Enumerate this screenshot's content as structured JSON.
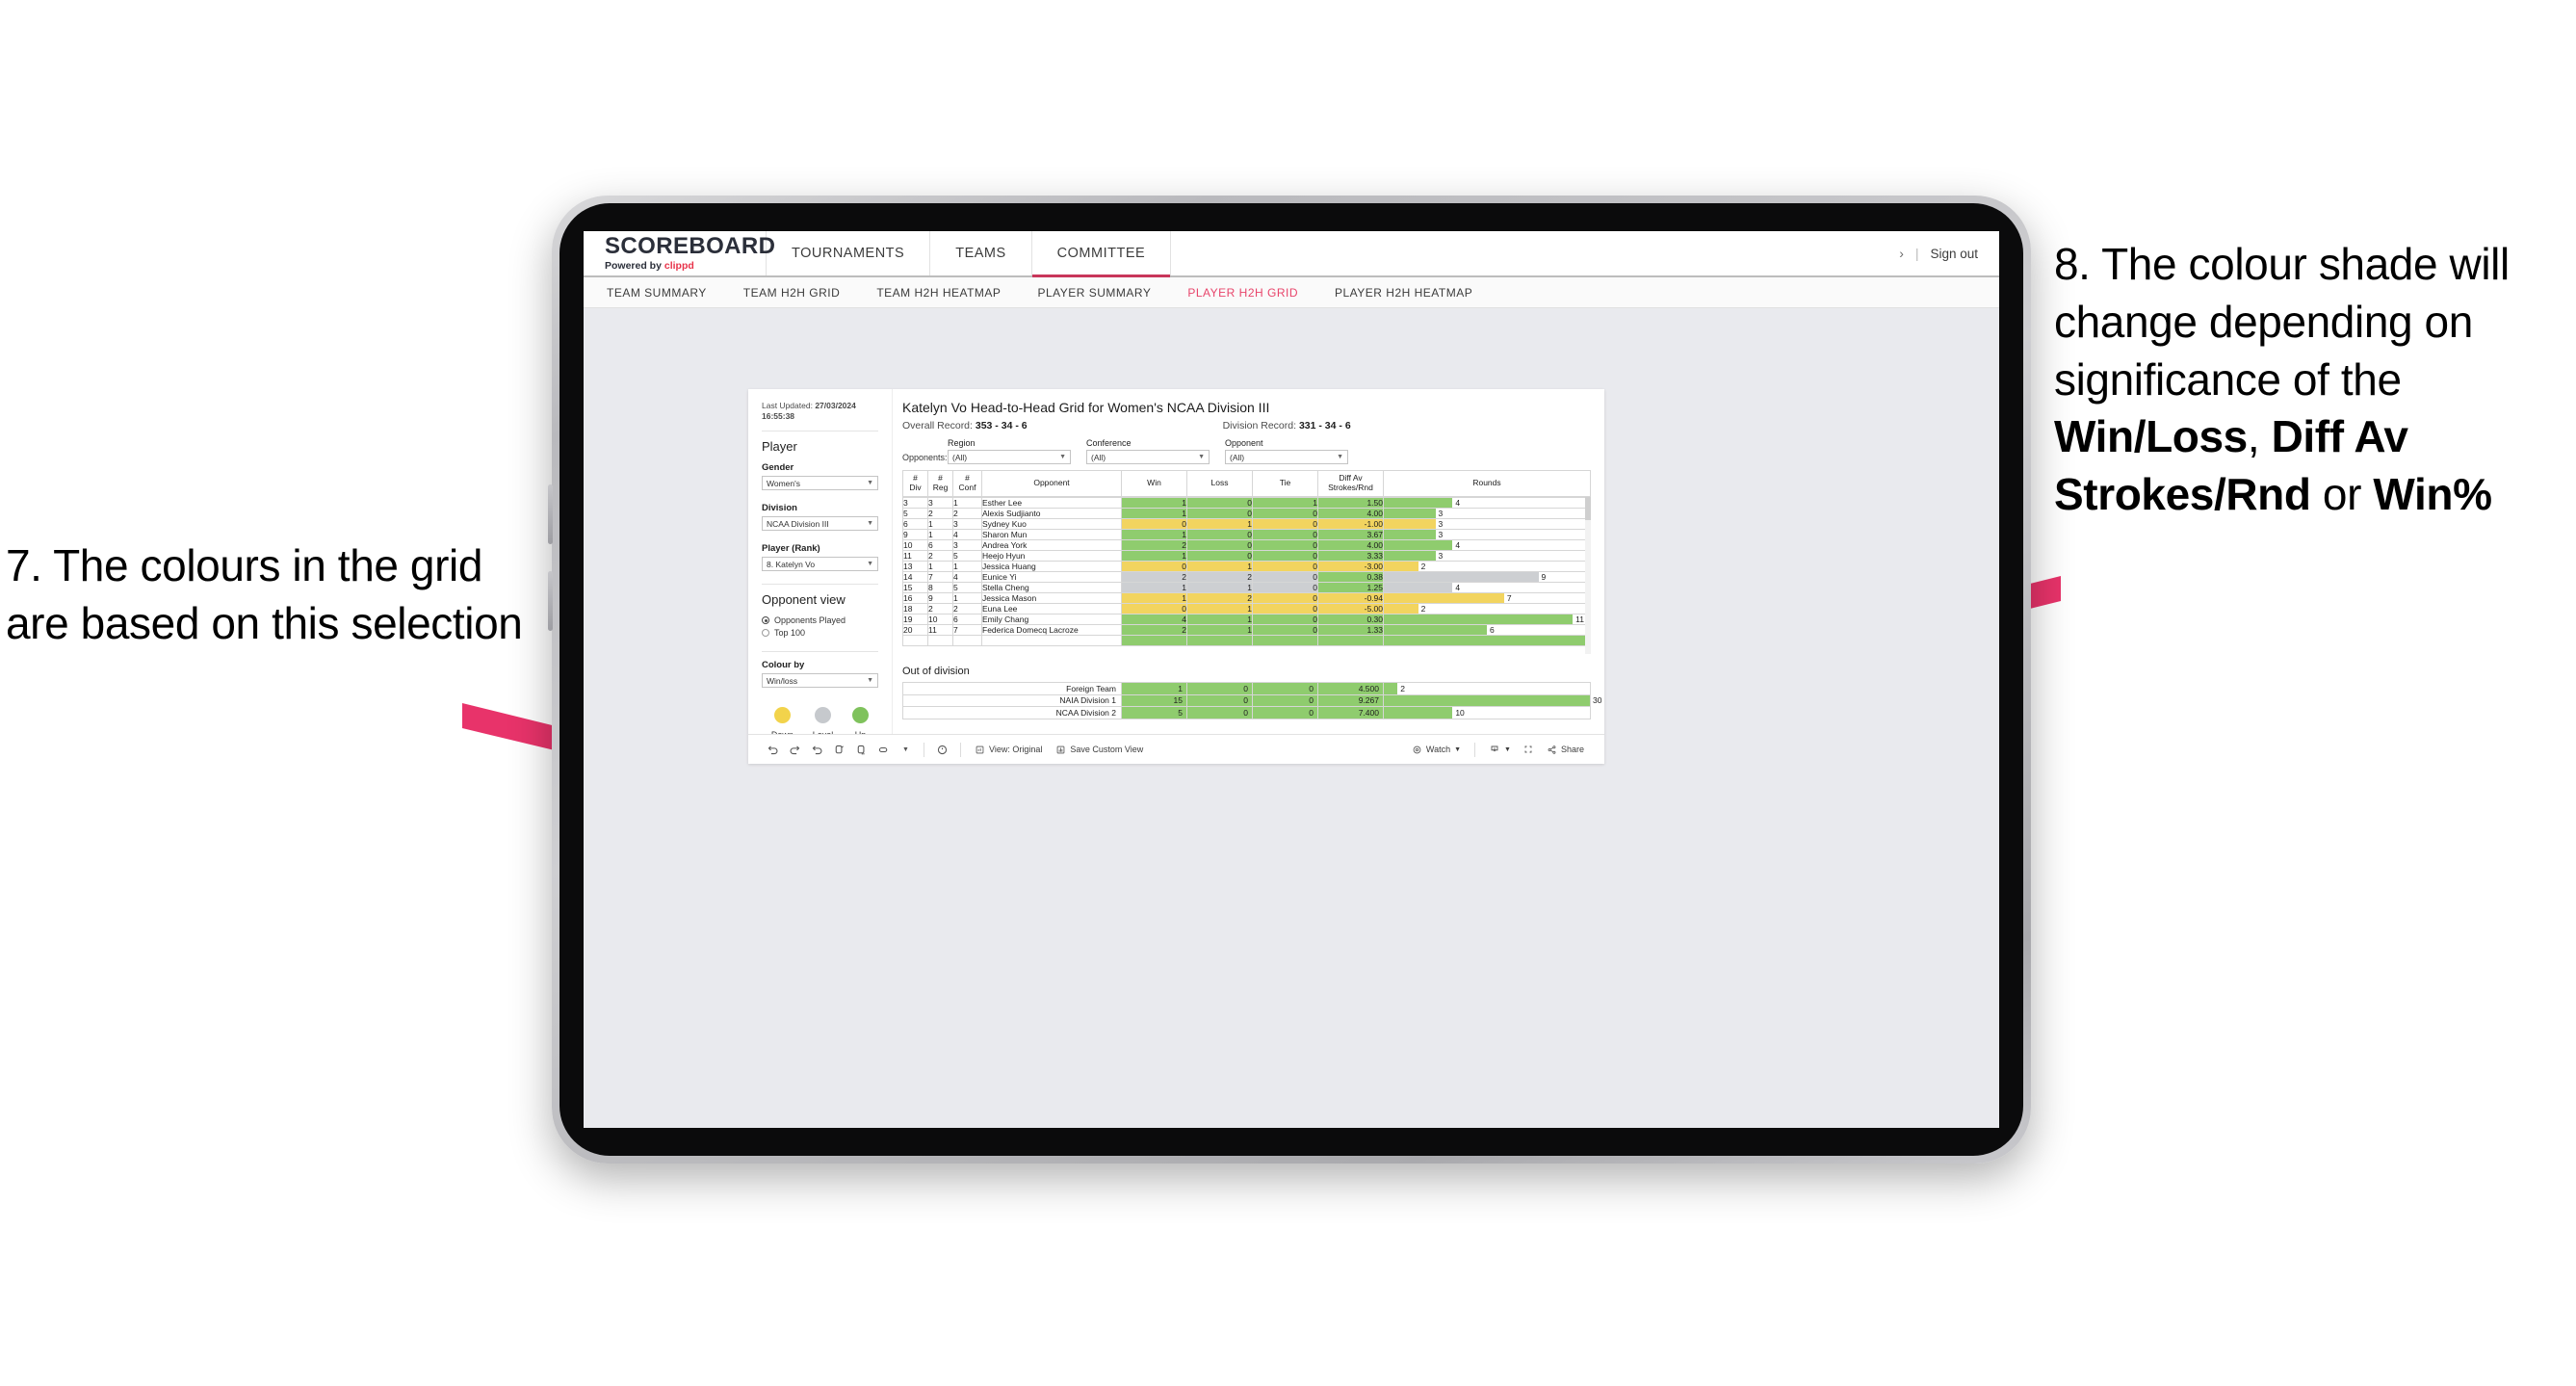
{
  "annotations": {
    "left": "7. The colours in the grid are based on this selection",
    "right_pre": "8. The colour shade will change depending on significance of the ",
    "right_b1": "Win/Loss",
    "right_mid1": ", ",
    "right_b2": "Diff Av Strokes/Rnd",
    "right_mid2": " or ",
    "right_b3": "Win%",
    "arrow_color": "#e8336a"
  },
  "header": {
    "logo_main": "SCOREBOARD",
    "logo_sub_pre": "Powered by ",
    "logo_brand": "clippd",
    "nav": [
      {
        "label": "TOURNAMENTS",
        "active": false
      },
      {
        "label": "TEAMS",
        "active": false
      },
      {
        "label": "COMMITTEE",
        "active": true
      }
    ],
    "chevron": "›",
    "divider": "|",
    "sign_out": "Sign out"
  },
  "subnav": [
    {
      "label": "TEAM SUMMARY",
      "active": false
    },
    {
      "label": "TEAM H2H GRID",
      "active": false
    },
    {
      "label": "TEAM H2H HEATMAP",
      "active": false
    },
    {
      "label": "PLAYER SUMMARY",
      "active": false
    },
    {
      "label": "PLAYER H2H GRID",
      "active": true
    },
    {
      "label": "PLAYER H2H HEATMAP",
      "active": false
    }
  ],
  "sidebar": {
    "last_updated_label": "Last Updated:",
    "last_updated_value": "27/03/2024 16:55:38",
    "section_player": "Player",
    "gender_label": "Gender",
    "gender_value": "Women's",
    "division_label": "Division",
    "division_value": "NCAA Division III",
    "player_label": "Player (Rank)",
    "player_value": "8. Katelyn Vo",
    "opponent_view_label": "Opponent view",
    "opponent_options": [
      {
        "label": "Opponents Played",
        "selected": true
      },
      {
        "label": "Top 100",
        "selected": false
      }
    ],
    "colour_by_label": "Colour by",
    "colour_by_value": "Win/loss",
    "legend": [
      {
        "label": "Down",
        "color": "#f2d34b"
      },
      {
        "label": "Level",
        "color": "#c6c9cd"
      },
      {
        "label": "Up",
        "color": "#7fc25c"
      }
    ]
  },
  "main": {
    "title": "Katelyn Vo Head-to-Head Grid for Women's NCAA Division III",
    "overall_record_label": "Overall Record:",
    "overall_record_value": "353 - 34 - 6",
    "division_record_label": "Division Record:",
    "division_record_value": "331 - 34 - 6",
    "opponents_label": "Opponents:",
    "filters": [
      {
        "label": "Region",
        "value": "(All)"
      },
      {
        "label": "Conference",
        "value": "(All)"
      },
      {
        "label": "Opponent",
        "value": "(All)"
      }
    ],
    "columns": [
      "# Div",
      "# Reg",
      "# Conf",
      "Opponent",
      "Win",
      "Loss",
      "Tie",
      "Diff Av Strokes/Rnd",
      "Rounds"
    ],
    "column_lines": [
      [
        "#",
        "Div"
      ],
      [
        "#",
        "Reg"
      ],
      [
        "#",
        "Conf"
      ],
      [
        "Opponent"
      ],
      [
        "Win"
      ],
      [
        "Loss"
      ],
      [
        "Tie"
      ],
      [
        "Diff Av",
        "Strokes/Rnd"
      ],
      [
        "Rounds"
      ]
    ],
    "rows": [
      {
        "div": "3",
        "reg": "3",
        "conf": "1",
        "opponent": "Esther Lee",
        "win": "1",
        "loss": "0",
        "tie": "1",
        "diff": "1.50",
        "rounds": "4",
        "color": "#8fcc6e"
      },
      {
        "div": "5",
        "reg": "2",
        "conf": "2",
        "opponent": "Alexis Sudjianto",
        "win": "1",
        "loss": "0",
        "tie": "0",
        "diff": "4.00",
        "rounds": "3",
        "color": "#8fcc6e"
      },
      {
        "div": "6",
        "reg": "1",
        "conf": "3",
        "opponent": "Sydney Kuo",
        "win": "0",
        "loss": "1",
        "tie": "0",
        "diff": "-1.00",
        "rounds": "3",
        "color": "#f2d45f"
      },
      {
        "div": "9",
        "reg": "1",
        "conf": "4",
        "opponent": "Sharon Mun",
        "win": "1",
        "loss": "0",
        "tie": "0",
        "diff": "3.67",
        "rounds": "3",
        "color": "#8fcc6e"
      },
      {
        "div": "10",
        "reg": "6",
        "conf": "3",
        "opponent": "Andrea York",
        "win": "2",
        "loss": "0",
        "tie": "0",
        "diff": "4.00",
        "rounds": "4",
        "color": "#8fcc6e"
      },
      {
        "div": "11",
        "reg": "2",
        "conf": "5",
        "opponent": "Heejo Hyun",
        "win": "1",
        "loss": "0",
        "tie": "0",
        "diff": "3.33",
        "rounds": "3",
        "color": "#8fcc6e"
      },
      {
        "div": "13",
        "reg": "1",
        "conf": "1",
        "opponent": "Jessica Huang",
        "win": "0",
        "loss": "1",
        "tie": "0",
        "diff": "-3.00",
        "rounds": "2",
        "color": "#f2d45f"
      },
      {
        "div": "14",
        "reg": "7",
        "conf": "4",
        "opponent": "Eunice Yi",
        "win": "2",
        "loss": "2",
        "tie": "0",
        "diff": "0.38",
        "rounds": "9",
        "color": "#cdcfd2",
        "diff_color": "#8fcc6e"
      },
      {
        "div": "15",
        "reg": "8",
        "conf": "5",
        "opponent": "Stella Cheng",
        "win": "1",
        "loss": "1",
        "tie": "0",
        "diff": "1.25",
        "rounds": "4",
        "color": "#cdcfd2",
        "diff_color": "#8fcc6e"
      },
      {
        "div": "16",
        "reg": "9",
        "conf": "1",
        "opponent": "Jessica Mason",
        "win": "1",
        "loss": "2",
        "tie": "0",
        "diff": "-0.94",
        "rounds": "7",
        "color": "#f2d45f"
      },
      {
        "div": "18",
        "reg": "2",
        "conf": "2",
        "opponent": "Euna Lee",
        "win": "0",
        "loss": "1",
        "tie": "0",
        "diff": "-5.00",
        "rounds": "2",
        "color": "#f2d45f"
      },
      {
        "div": "19",
        "reg": "10",
        "conf": "6",
        "opponent": "Emily Chang",
        "win": "4",
        "loss": "1",
        "tie": "0",
        "diff": "0.30",
        "rounds": "11",
        "color": "#8fcc6e"
      },
      {
        "div": "20",
        "reg": "11",
        "conf": "7",
        "opponent": "Federica Domecq Lacroze",
        "win": "2",
        "loss": "1",
        "tie": "0",
        "diff": "1.33",
        "rounds": "6",
        "color": "#8fcc6e"
      }
    ],
    "out_of_division_title": "Out of division",
    "out_of_division": [
      {
        "name": "Foreign Team",
        "win": "1",
        "loss": "0",
        "tie": "0",
        "diff": "4.500",
        "rounds": "2",
        "color": "#8fcc6e"
      },
      {
        "name": "NAIA Division 1",
        "win": "15",
        "loss": "0",
        "tie": "0",
        "diff": "9.267",
        "rounds": "30",
        "color": "#8fcc6e"
      },
      {
        "name": "NCAA Division 2",
        "win": "5",
        "loss": "0",
        "tie": "0",
        "diff": "7.400",
        "rounds": "10",
        "color": "#8fcc6e"
      }
    ]
  },
  "toolbar": {
    "icons": [
      "undo-icon",
      "redo-icon",
      "revert-icon",
      "refresh-icon",
      "pause-icon",
      "shape-icon",
      "chevron-down-icon"
    ],
    "alert_icon": "alert-icon",
    "view_button": "View: Original",
    "save_button": "Save Custom View",
    "watch_button": "Watch",
    "download_icon": "download-icon",
    "fullscreen_icon": "fullscreen-icon",
    "share_button": "Share"
  }
}
